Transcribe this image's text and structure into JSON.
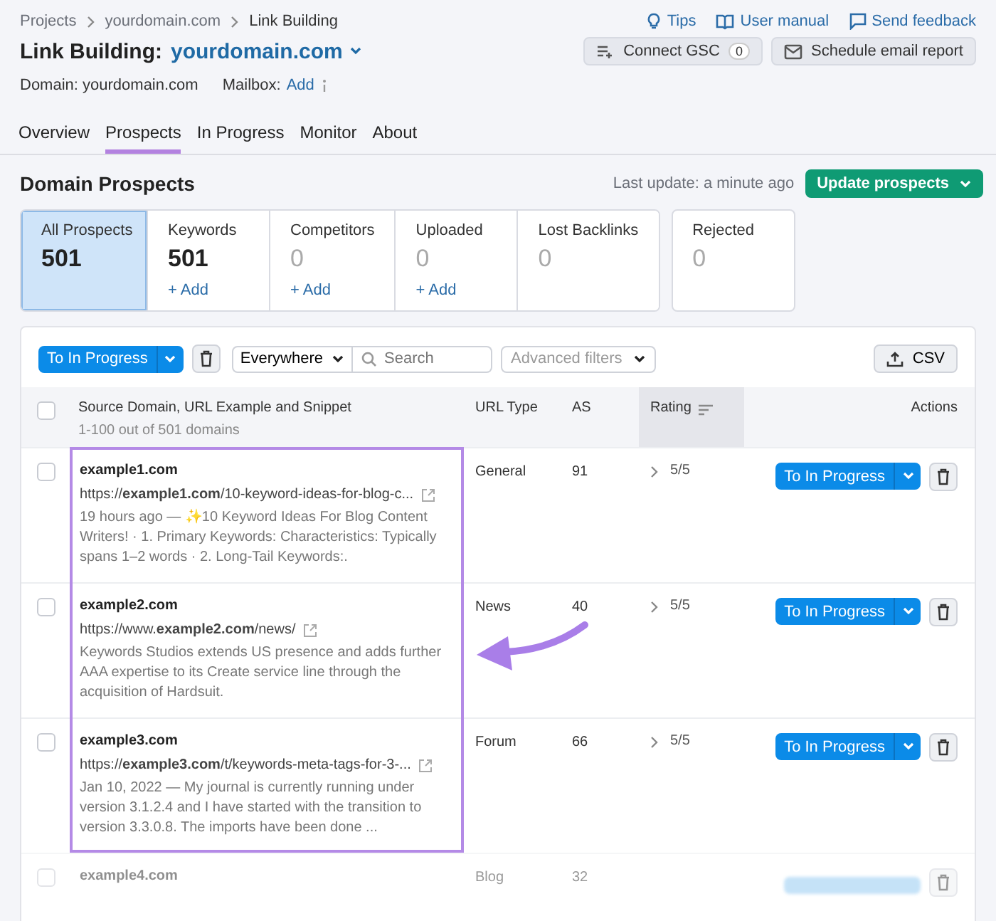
{
  "breadcrumbs": [
    "Projects",
    "yourdomain.com",
    "Link Building"
  ],
  "header_links": [
    "Tips",
    "User manual",
    "Send feedback"
  ],
  "title": {
    "prefix": "Link Building:",
    "domain": "yourdomain.com"
  },
  "header_buttons": {
    "connect_gsc": {
      "label": "Connect GSC",
      "count": "0"
    },
    "schedule": {
      "label": "Schedule email report"
    }
  },
  "meta": {
    "domain": "Domain: yourdomain.com",
    "mailbox_label": "Mailbox:",
    "mailbox_link": "Add"
  },
  "tabs": [
    {
      "label": "Overview",
      "selected": false
    },
    {
      "label": "Prospects",
      "selected": true
    },
    {
      "label": "In Progress",
      "selected": false
    },
    {
      "label": "Monitor",
      "selected": false
    },
    {
      "label": "About",
      "selected": false
    }
  ],
  "section": {
    "title": "Domain Prospects",
    "last_update": "Last update: a minute ago",
    "update_button": "Update prospects"
  },
  "prospect_tabs": [
    {
      "label": "All Prospects",
      "count": "501",
      "empty": false,
      "selected": true
    },
    {
      "label": "Keywords",
      "count": "501",
      "empty": false,
      "selected": false,
      "add": "+ Add"
    },
    {
      "label": "Competitors",
      "count": "0",
      "empty": true,
      "selected": false,
      "add": "+ Add"
    },
    {
      "label": "Uploaded",
      "count": "0",
      "empty": true,
      "selected": false,
      "add": "+ Add"
    },
    {
      "label": "Lost Backlinks",
      "count": "0",
      "empty": true,
      "selected": false
    }
  ],
  "rejected_tab": {
    "label": "Rejected",
    "count": "0",
    "empty": true,
    "selected": false
  },
  "toolbar": {
    "primary_button": "To In Progress",
    "scope": "Everywhere",
    "search_placeholder": "Search",
    "advanced_filters": "Advanced filters",
    "export": "CSV"
  },
  "table": {
    "select_all_checked": false,
    "columns": [
      {
        "label": "Source Domain, URL Example and Snippet",
        "sub": "1-100 out of 501 domains",
        "sorted": false
      },
      {
        "label": "URL Type",
        "sorted": false
      },
      {
        "label": "AS",
        "sorted": false
      },
      {
        "label": "Rating",
        "sorted": true
      },
      {
        "label": "Actions",
        "sorted": false
      }
    ],
    "rows": [
      {
        "domain": "example1.com",
        "url": "https://**example1.com**/10-keyword-ideas-for-blog-c...",
        "snippet": "19 hours ago — ✨10 Keyword Ideas For Blog Content Writers! · 1. Primary Keywords: Characteristics: Typically spans 1–2 words · 2. Long-Tail Keywords:.",
        "url_type": "General",
        "as": "91",
        "rating": "5/5",
        "action": "To In Progress",
        "checked": false,
        "highlighted": true,
        "faded": false
      },
      {
        "domain": "example2.com",
        "url": "https://www.**example2.com**/news/",
        "snippet": "Keywords Studios extends US presence and adds further AAA expertise to its Create service line through the acquisition of Hardsuit.",
        "url_type": "News",
        "as": "40",
        "rating": "5/5",
        "action": "To In Progress",
        "checked": false,
        "highlighted": true,
        "faded": false
      },
      {
        "domain": "example3.com",
        "url": "https://**example3.com**/t/keywords-meta-tags-for-3-...",
        "snippet": "Jan 10, 2022 — My journal is currently running under version 3.1.2.4 and I have started with the transition to version 3.3.0.8. The imports have been done ...",
        "url_type": "Forum",
        "as": "66",
        "rating": "5/5",
        "action": "To In Progress",
        "checked": false,
        "highlighted": true,
        "faded": false
      },
      {
        "domain": "example4.com",
        "url_type": "Blog",
        "as": "32",
        "checked": false,
        "highlighted": false,
        "faded": true
      }
    ]
  }
}
